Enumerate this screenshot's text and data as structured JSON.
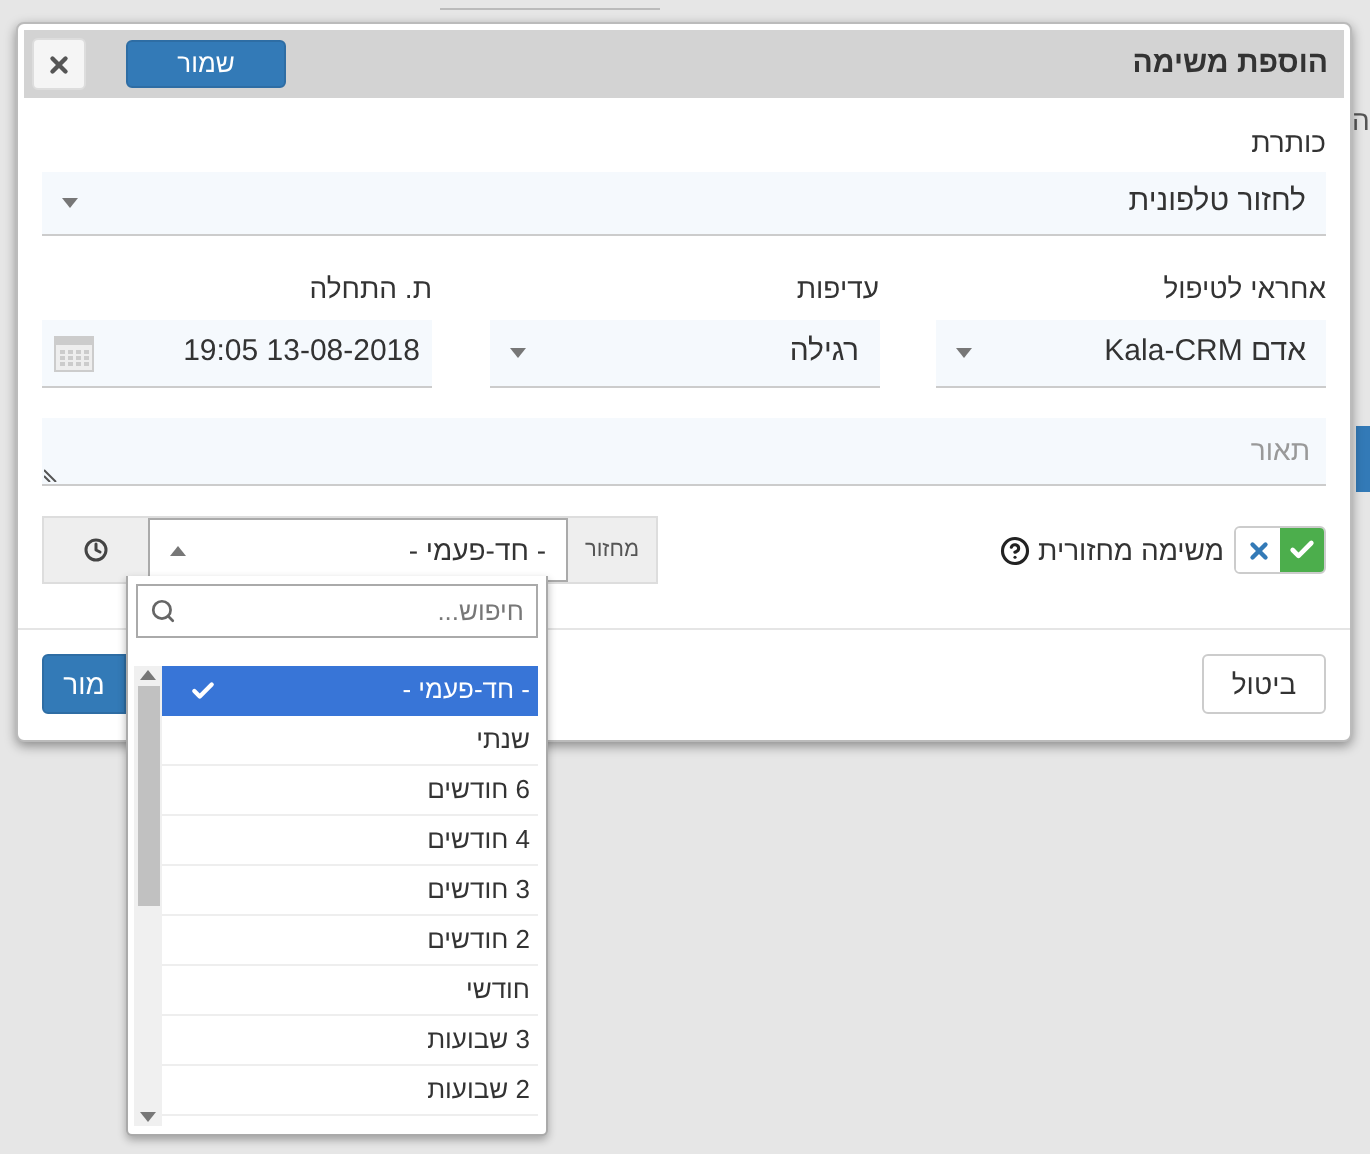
{
  "background": {
    "side_text": "ה"
  },
  "dialog": {
    "title": "הוספת משימה",
    "header_save": "שמור",
    "subject": {
      "label": "כותרת",
      "value": "לחזור טלפונית"
    },
    "fields": [
      {
        "kind": "select",
        "label": "אחראי לטיפול",
        "value": "אדם Kala-CRM"
      },
      {
        "kind": "select",
        "label": "עדיפות",
        "value": "רגילה"
      },
      {
        "kind": "date",
        "label": "ת. התחלה",
        "value": "19:05 13-08-2018"
      }
    ],
    "description": {
      "placeholder": "תאור"
    },
    "recurring": {
      "label": "משימה מחזורית",
      "on": true,
      "cycle_label": "מחזור",
      "cycle_value": "- חד-פעמי -"
    },
    "cancel": "ביטול",
    "save": "מור"
  },
  "dropdown": {
    "search_placeholder": "חיפוש...",
    "options": [
      {
        "label": "- חד-פעמי -",
        "selected": true
      },
      {
        "label": "שנתי",
        "selected": false
      },
      {
        "label": "6 חודשים",
        "selected": false
      },
      {
        "label": "4 חודשים",
        "selected": false
      },
      {
        "label": "3 חודשים",
        "selected": false
      },
      {
        "label": "2 חודשים",
        "selected": false
      },
      {
        "label": "חודשי",
        "selected": false
      },
      {
        "label": "3 שבועות",
        "selected": false
      },
      {
        "label": "2 שבועות",
        "selected": false
      }
    ]
  }
}
